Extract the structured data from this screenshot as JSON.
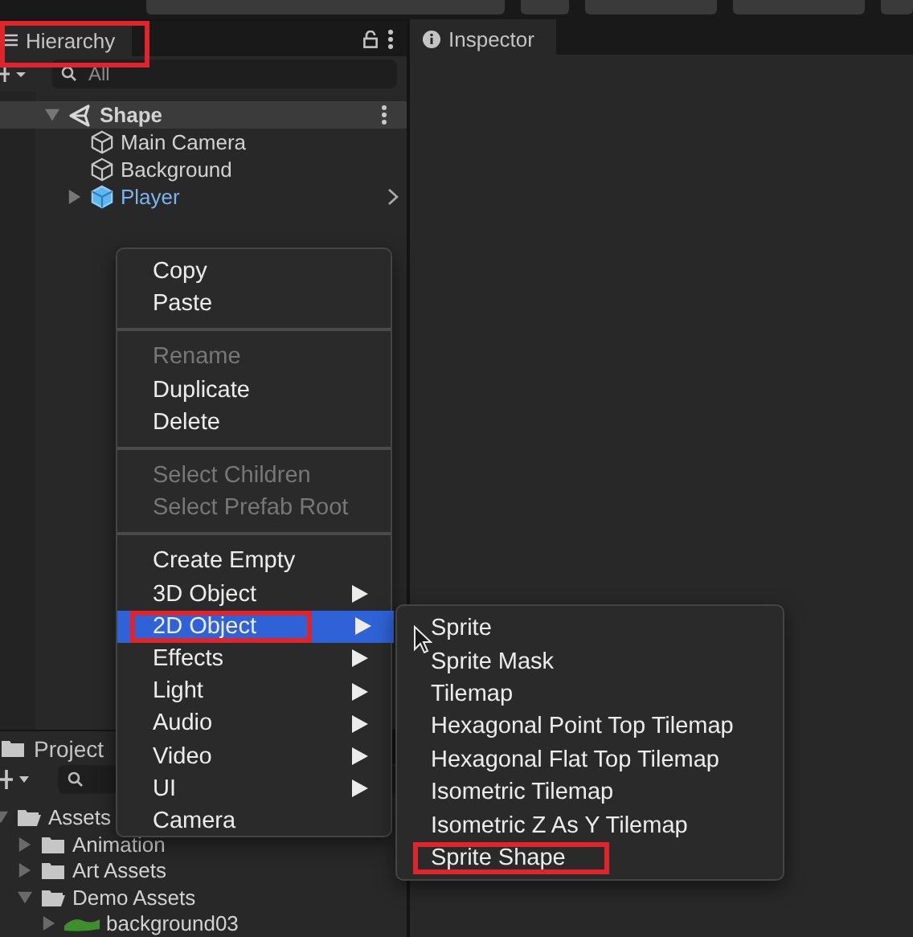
{
  "hierarchy": {
    "title": "Hierarchy",
    "highlighted": true,
    "search": {
      "placeholder": "All"
    },
    "tree": [
      {
        "name": "Shape",
        "kind": "scene",
        "expanded": true,
        "children": [
          {
            "name": "Main Camera",
            "kind": "object"
          },
          {
            "name": "Background",
            "kind": "object"
          },
          {
            "name": "Player",
            "kind": "prefab",
            "expanded": false
          }
        ]
      }
    ]
  },
  "inspector": {
    "title": "Inspector"
  },
  "project": {
    "title": "Project",
    "tree": [
      {
        "name": "Assets",
        "kind": "folder",
        "expanded": true,
        "children": [
          {
            "name": "Animation",
            "kind": "folder",
            "expanded": false
          },
          {
            "name": "Art Assets",
            "kind": "folder",
            "expanded": false
          },
          {
            "name": "Demo Assets",
            "kind": "folder",
            "expanded": true,
            "children": [
              {
                "name": "background03",
                "kind": "image",
                "expanded": false
              }
            ]
          }
        ]
      }
    ]
  },
  "context_menu": {
    "items": [
      {
        "kind": "item",
        "label": "Copy",
        "disabled": false
      },
      {
        "kind": "item",
        "label": "Paste",
        "disabled": false
      },
      {
        "kind": "separator"
      },
      {
        "kind": "item",
        "label": "Rename",
        "disabled": true
      },
      {
        "kind": "item",
        "label": "Duplicate",
        "disabled": false
      },
      {
        "kind": "item",
        "label": "Delete",
        "disabled": false
      },
      {
        "kind": "separator"
      },
      {
        "kind": "item",
        "label": "Select Children",
        "disabled": true
      },
      {
        "kind": "item",
        "label": "Select Prefab Root",
        "disabled": true
      },
      {
        "kind": "separator"
      },
      {
        "kind": "item",
        "label": "Create Empty",
        "disabled": false
      },
      {
        "kind": "submenu",
        "label": "3D Object",
        "disabled": false,
        "selected": false
      },
      {
        "kind": "submenu",
        "label": "2D Object",
        "disabled": false,
        "selected": true,
        "highlighted": true
      },
      {
        "kind": "submenu",
        "label": "Effects",
        "disabled": false,
        "selected": false
      },
      {
        "kind": "submenu",
        "label": "Light",
        "disabled": false,
        "selected": false
      },
      {
        "kind": "submenu",
        "label": "Audio",
        "disabled": false,
        "selected": false
      },
      {
        "kind": "submenu",
        "label": "Video",
        "disabled": false,
        "selected": false
      },
      {
        "kind": "submenu",
        "label": "UI",
        "disabled": false,
        "selected": false
      },
      {
        "kind": "item",
        "label": "Camera",
        "disabled": false
      }
    ]
  },
  "submenu": {
    "items": [
      {
        "label": "Sprite",
        "highlighted": false
      },
      {
        "label": "Sprite Mask",
        "highlighted": false
      },
      {
        "label": "Tilemap",
        "highlighted": false
      },
      {
        "label": "Hexagonal Point Top Tilemap",
        "highlighted": false
      },
      {
        "label": "Hexagonal Flat Top Tilemap",
        "highlighted": false
      },
      {
        "label": "Isometric Tilemap",
        "highlighted": false
      },
      {
        "label": "Isometric Z As Y Tilemap",
        "highlighted": false
      },
      {
        "label": "Sprite Shape",
        "highlighted": true
      }
    ]
  }
}
